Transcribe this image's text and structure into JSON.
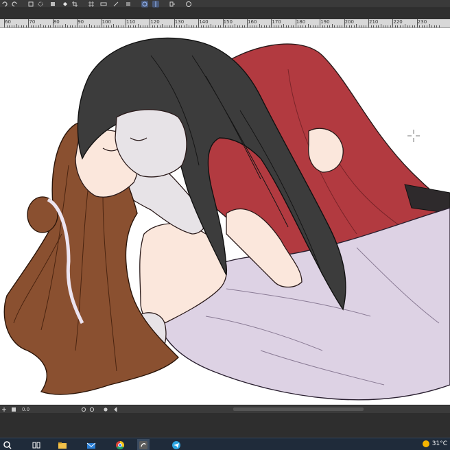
{
  "ruler": {
    "labels": [
      "60",
      "70",
      "80",
      "90",
      "100",
      "110",
      "120",
      "130",
      "140",
      "150",
      "160",
      "170",
      "180",
      "190",
      "200",
      "210",
      "220",
      "230"
    ]
  },
  "statusbar": {
    "zoom_value": "0.0"
  },
  "taskbar": {
    "temperature": "31°C"
  },
  "colors": {
    "robe_red": "#b23a40",
    "robe_lavender": "#ddd2e4",
    "hair_dark": "#3c3c3c",
    "hair_brown": "#8a5030",
    "skin": "#fbe7dc",
    "pale_skin": "#e7e3e7"
  }
}
